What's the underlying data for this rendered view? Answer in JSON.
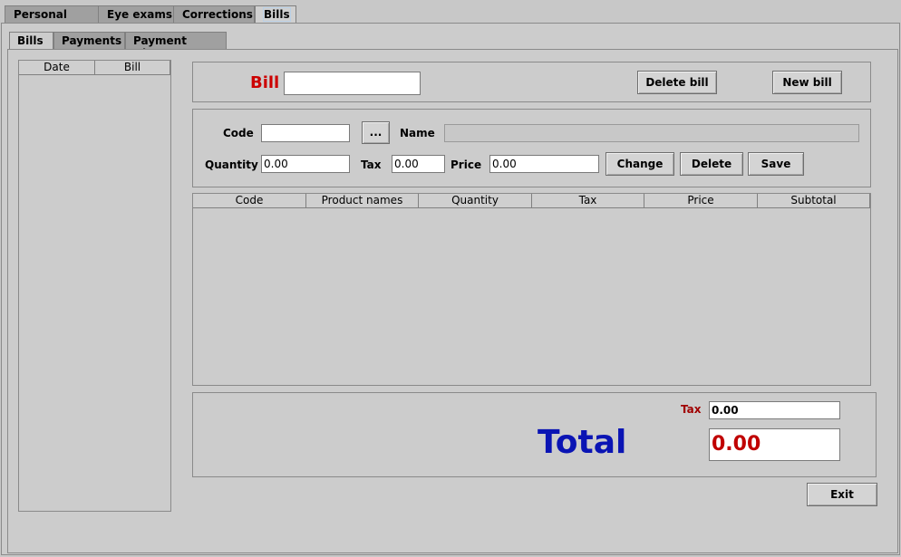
{
  "top_tabs": [
    "Personal Data",
    "Eye exams",
    "Corrections",
    "Bills"
  ],
  "sub_tabs": [
    "Bills",
    "Payments",
    "Payment History"
  ],
  "bill_list": {
    "columns": [
      "Date",
      "Bill"
    ]
  },
  "bill_header": {
    "label": "Bill",
    "value": "",
    "delete_bill": "Delete bill",
    "new_bill": "New bill"
  },
  "item_form": {
    "code_label": "Code",
    "code_value": "",
    "browse_label": "...",
    "name_label": "Name",
    "name_value": "",
    "quantity_label": "Quantity",
    "quantity_value": "0.00",
    "tax_label": "Tax",
    "tax_value": "0.00",
    "price_label": "Price",
    "price_value": "0.00",
    "change": "Change",
    "delete": "Delete",
    "save": "Save"
  },
  "items_table": {
    "columns": [
      "Code",
      "Product names",
      "Quantity",
      "Tax",
      "Price",
      "Subtotal"
    ]
  },
  "totals": {
    "tax_label": "Tax",
    "tax_value": "0.00",
    "total_label": "Total",
    "total_value": "0.00"
  },
  "exit": "Exit",
  "colors": {
    "bill_label": "#cc0000",
    "total_label": "#0a14b4",
    "total_value": "#c00000",
    "tax_label": "#a00000"
  }
}
